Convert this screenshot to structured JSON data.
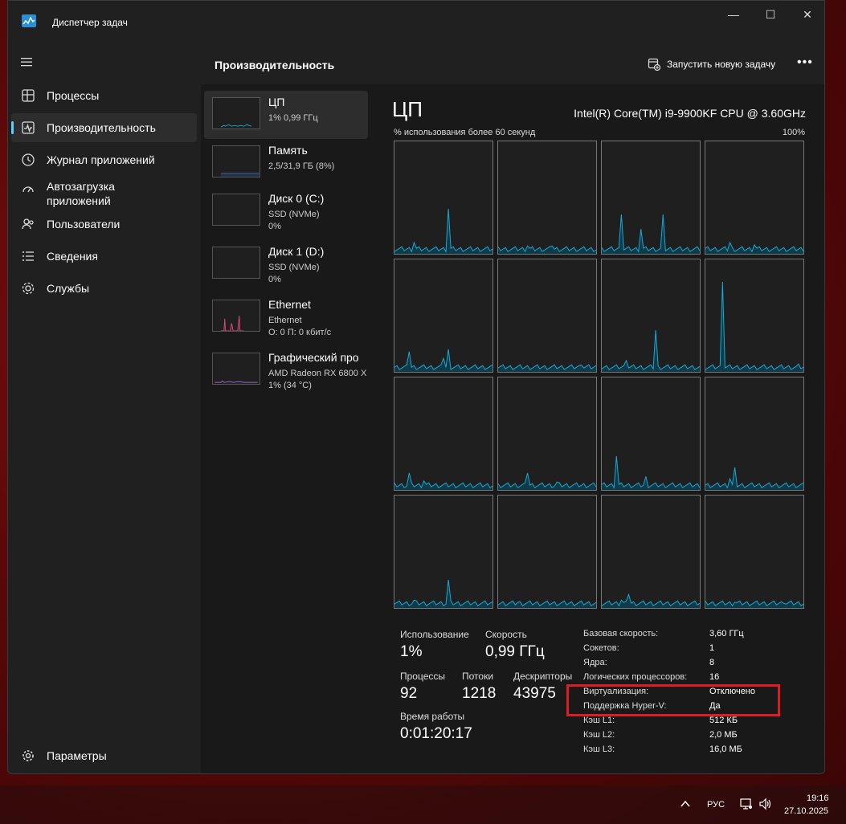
{
  "app": {
    "title": "Диспетчер задач"
  },
  "window_controls": {
    "minimize": "—",
    "maximize": "☐",
    "close": "✕"
  },
  "sidebar": {
    "items": [
      {
        "label": "Процессы",
        "icon": "processes-icon"
      },
      {
        "label": "Производительность",
        "icon": "performance-icon",
        "active": true
      },
      {
        "label": "Журнал приложений",
        "icon": "history-icon"
      },
      {
        "label": "Автозагрузка приложений",
        "line1": "Автозагрузка",
        "line2": "приложений",
        "icon": "startup-icon"
      },
      {
        "label": "Пользователи",
        "icon": "users-icon"
      },
      {
        "label": "Сведения",
        "icon": "details-icon"
      },
      {
        "label": "Службы",
        "icon": "services-icon"
      }
    ],
    "settings_label": "Параметры"
  },
  "header": {
    "title": "Производительность",
    "run_task_label": "Запустить новую задачу",
    "more_label": "•••"
  },
  "devices": [
    {
      "name": "ЦП",
      "sub1": "1% 0,99 ГГц",
      "sub2": "",
      "active": true
    },
    {
      "name": "Память",
      "sub1": "2,5/31,9 ГБ (8%)",
      "sub2": ""
    },
    {
      "name": "Диск 0 (C:)",
      "sub1": "SSD (NVMe)",
      "sub2": "0%"
    },
    {
      "name": "Диск 1 (D:)",
      "sub1": "SSD (NVMe)",
      "sub2": "0%"
    },
    {
      "name": "Ethernet",
      "sub1": "Ethernet",
      "sub2": "О: 0 П: 0 кбит/с"
    },
    {
      "name": "Графический про",
      "sub1": "AMD Radeon RX 6800 X",
      "sub2": "1% (34 °C)"
    }
  ],
  "cpu": {
    "title": "ЦП",
    "model": "Intel(R) Core(TM) i9-9900KF CPU @ 3.60GHz",
    "graph_label": "% использования более 60 секунд",
    "graph_max": "100%",
    "stats": {
      "usage_label": "Использование",
      "usage_value": "1%",
      "speed_label": "Скорость",
      "speed_value": "0,99 ГГц",
      "processes_label": "Процессы",
      "processes_value": "92",
      "threads_label": "Потоки",
      "threads_value": "1218",
      "handles_label": "Дескрипторы",
      "handles_value": "43975",
      "uptime_label": "Время работы",
      "uptime_value": "0:01:20:17"
    },
    "info": [
      {
        "key": "Базовая скорость:",
        "value": "3,60 ГГц"
      },
      {
        "key": "Сокетов:",
        "value": "1"
      },
      {
        "key": "Ядра:",
        "value": "8"
      },
      {
        "key": "Логических процессоров:",
        "value": "16"
      },
      {
        "key": "Виртуализация:",
        "value": "Отключено"
      },
      {
        "key": "Поддержка Hyper-V:",
        "value": "Да"
      },
      {
        "key": "Кэш L1:",
        "value": "512 КБ"
      },
      {
        "key": "Кэш L2:",
        "value": "2,0 МБ"
      },
      {
        "key": "Кэш L3:",
        "value": "16,0 МБ"
      }
    ]
  },
  "colors": {
    "accent": "#60cdff",
    "cpu_line": "#17a9d4",
    "ethernet_line": "#d24b7a",
    "highlight": "#e01b24"
  },
  "taskbar": {
    "lang": "РУС",
    "time": "19:16",
    "date": "27.10.2025"
  }
}
